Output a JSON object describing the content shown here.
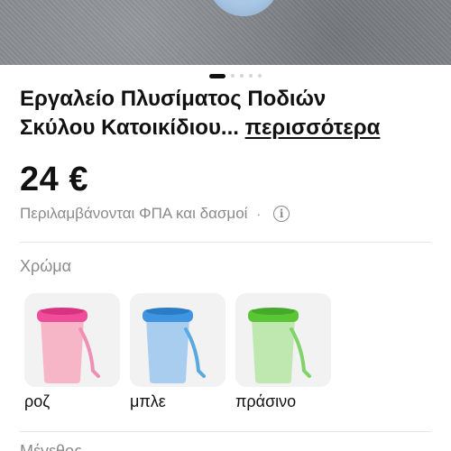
{
  "product": {
    "title_line1": "Εργαλείο Πλυσίματος Ποδιών",
    "title_line2": "Σκύλου Κατοικίδιου...",
    "more_link": "περισσότερα",
    "price": "24 €",
    "vat_note": "Περιλαμβάνονται ΦΠΑ και δασμοί",
    "vat_separator": "·",
    "info_icon": "info-icon"
  },
  "gallery": {
    "active_index": 0,
    "dot_count": 5
  },
  "color_option": {
    "label": "Χρώμα",
    "options": [
      {
        "name": "ροζ",
        "cup": "#f7b6c8",
        "rim": "#ef4f9a",
        "strap": "#f08fb6"
      },
      {
        "name": "μπλε",
        "cup": "#a9cdef",
        "rim": "#3f95e0",
        "strap": "#5aa9e0"
      },
      {
        "name": "πράσινο",
        "cup": "#bfe8b0",
        "rim": "#5ac636",
        "strap": "#7fd36a"
      }
    ]
  },
  "next_section_label": "Μέγεθος"
}
